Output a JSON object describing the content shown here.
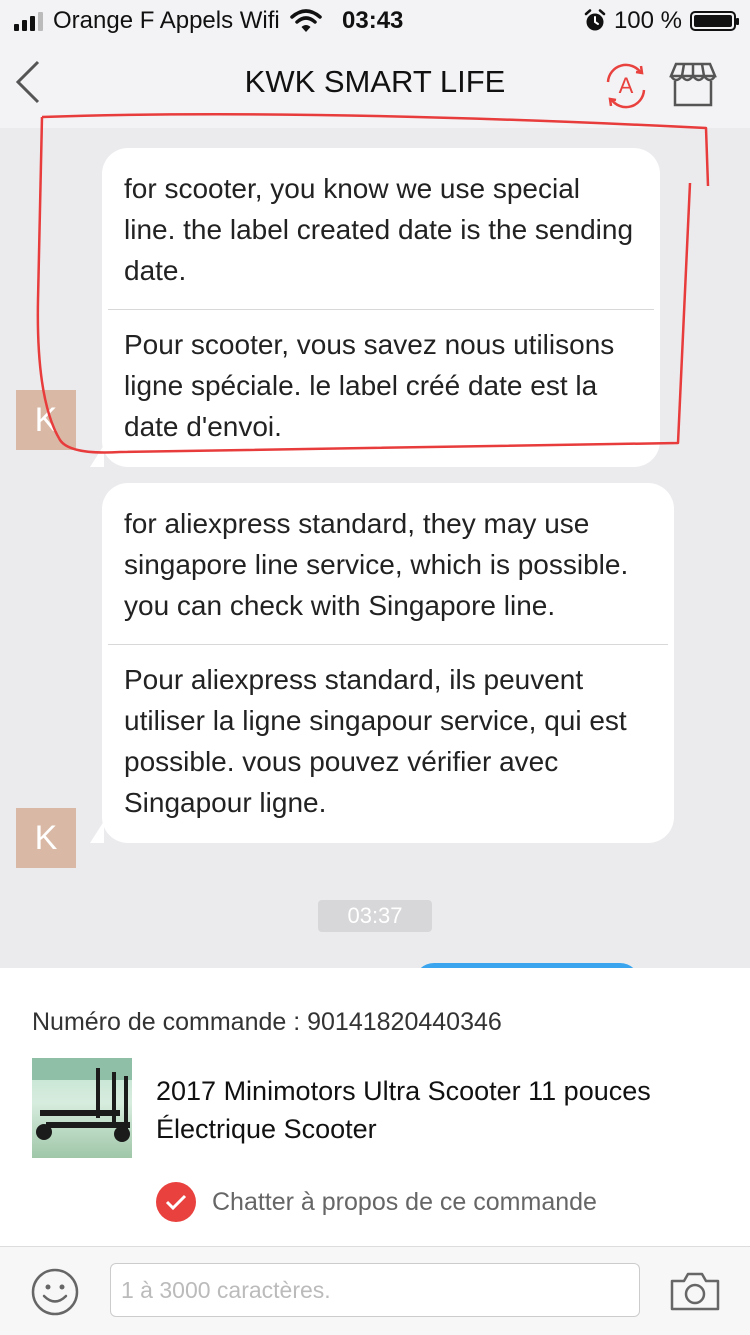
{
  "status_bar": {
    "carrier": "Orange F Appels Wifi",
    "time": "03:43",
    "battery": "100 %",
    "icons": [
      "signal-icon",
      "wifi-icon",
      "alarm-icon",
      "battery-icon"
    ]
  },
  "header": {
    "title": "KWK SMART LIFE",
    "translate_badge": "A",
    "icons": [
      "back-chevron-icon",
      "translate-icon",
      "store-icon"
    ]
  },
  "messages": [
    {
      "avatar": "K",
      "original": "for scooter, you know we use special line. the label created date is the sending date.",
      "translation": "Pour scooter, vous savez nous utilisons ligne spéciale. le label créé date est la date d'envoi."
    },
    {
      "avatar": "K",
      "original": "for aliexpress standard, they may use singapore line service, which is possible. you can check with Singapore line.",
      "translation": "Pour aliexpress standard, ils peuvent utiliser la ligne singapour service, qui est possible. vous pouvez vérifier avec Singapour ligne."
    }
  ],
  "timestamp": "03:37",
  "order": {
    "number_label": "Numéro de commande : 90141820440346",
    "product_name": "2017 Minimotors Ultra Scooter 11 pouces Électrique Scooter",
    "chat_about": "Chatter à propos de ce commande"
  },
  "composer": {
    "placeholder": "1 à 3000 caractères.",
    "icons": [
      "emoji-icon",
      "camera-icon"
    ]
  },
  "colors": {
    "accent_red": "#e8413e",
    "avatar_bg": "#d9b9a6",
    "sent_bubble": "#3aa5ee",
    "chat_bg": "#ebebee"
  }
}
